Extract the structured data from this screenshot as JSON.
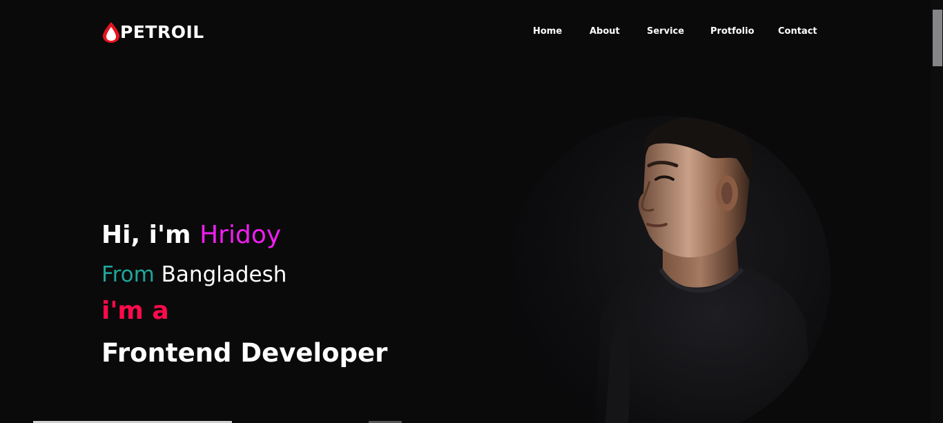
{
  "brand": {
    "logo_text": "PETROIL",
    "logo_icon": "drop-icon",
    "accent_color": "#e3141f"
  },
  "nav": {
    "items": [
      {
        "label": "Home"
      },
      {
        "label": "About"
      },
      {
        "label": "Service"
      },
      {
        "label": "Protfolio"
      },
      {
        "label": "Contact"
      }
    ]
  },
  "hero": {
    "line1_prefix": "Hi, i'm ",
    "name": "Hridoy",
    "line2_from": "From",
    "line2_country": " Bangladesh",
    "line3": "i'm a",
    "role": "Frontend Developer",
    "colors": {
      "name": "#f01ef0",
      "from": "#1fa69a",
      "im_a": "#ff0a4a",
      "text": "#ffffff"
    }
  },
  "theme": {
    "background": "#0a0a0b"
  }
}
